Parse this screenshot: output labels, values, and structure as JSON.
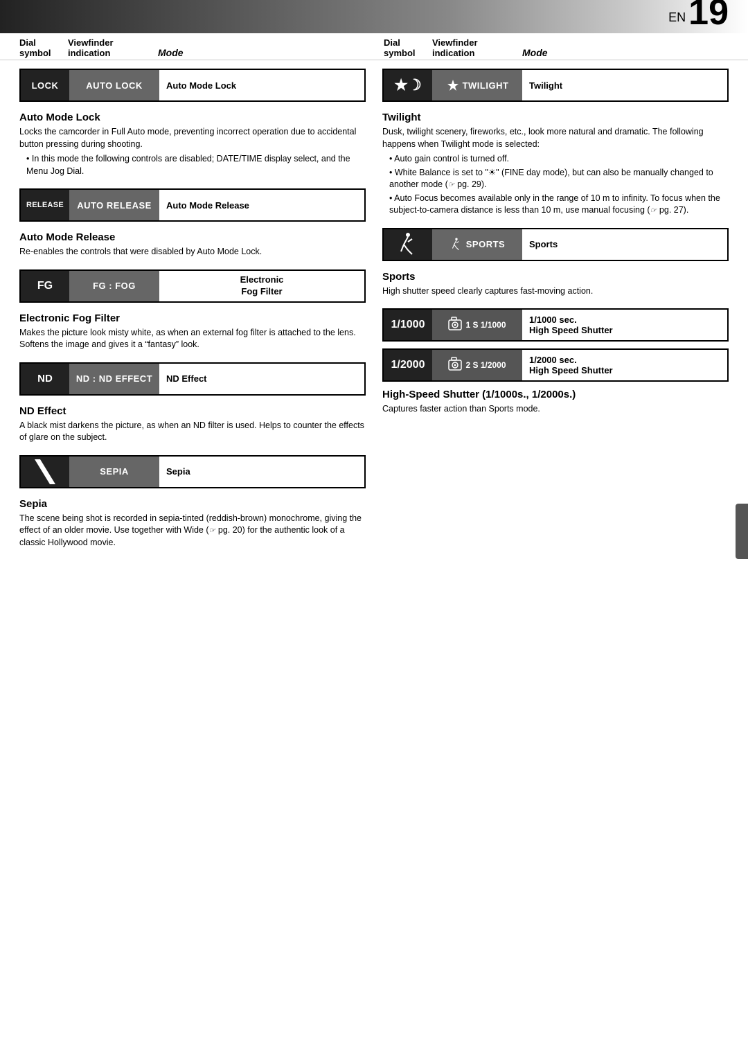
{
  "page": {
    "en_label": "EN",
    "page_number": "19"
  },
  "columns": {
    "left": {
      "header": {
        "symbol": "Dial\nsymbol",
        "indication": "Viewfinder\nindication",
        "mode": "Mode"
      },
      "sections": [
        {
          "id": "auto-mode-lock",
          "row": {
            "symbol_text": "LOCK",
            "indication_text": "AUTO LOCK",
            "mode_text": "Auto Mode Lock"
          },
          "title": "Auto Mode Lock",
          "body": "Locks the camcorder in Full Auto mode, preventing incorrect operation due to accidental button pressing during shooting.",
          "bullets": [
            "In this mode the following controls are disabled; DATE/TIME display select, and the Menu Jog Dial."
          ]
        },
        {
          "id": "auto-mode-release",
          "row": {
            "symbol_text": "RELEASE",
            "indication_text": "AUTO RELEASE",
            "mode_text": "Auto Mode Release"
          },
          "title": "Auto Mode Release",
          "body": "Re-enables the controls that were disabled by Auto Mode Lock.",
          "bullets": []
        },
        {
          "id": "electronic-fog-filter",
          "row": {
            "symbol_text": "FG",
            "indication_text": "FG : FOG",
            "mode_text": "Electronic\nFog Filter"
          },
          "title": "Electronic Fog Filter",
          "body": "Makes the picture look misty white, as when an external fog filter is attached to the lens. Softens the image and gives it a “fantasy” look.",
          "bullets": []
        },
        {
          "id": "nd-effect",
          "row": {
            "symbol_text": "ND",
            "indication_text": "ND : ND EFFECT",
            "mode_text": "ND Effect"
          },
          "title": "ND Effect",
          "body": "A black mist darkens the picture, as when an ND filter is used. Helps to counter the effects of glare on the subject.",
          "bullets": []
        },
        {
          "id": "sepia",
          "row": {
            "symbol_text": "╲",
            "indication_text": "SEPIA",
            "mode_text": "Sepia"
          },
          "title": "Sepia",
          "body": "The scene being shot is recorded in sepia-tinted (reddish-brown) monochrome, giving the effect of an older movie. Use together with Wide (ᵔᴷ pg. 20) for the authentic look of a classic Hollywood movie.",
          "bullets": []
        }
      ]
    },
    "right": {
      "header": {
        "symbol": "Dial\nsymbol",
        "indication": "Viewfinder\nindication",
        "mode": "Mode"
      },
      "sections": [
        {
          "id": "twilight",
          "row": {
            "symbol_text": "★☽",
            "indication_text": "TWILIGHT",
            "mode_text": "Twilight"
          },
          "title": "Twilight",
          "body": "Dusk, twilight scenery, fireworks, etc., look more natural and dramatic. The following happens when Twilight mode is selected:",
          "bullets": [
            "Auto gain control is turned off.",
            "White Balance is set to \"☀\" (FINE day mode), but can also be manually changed to another mode (ᵔᴷ pg. 29).",
            "Auto Focus becomes available only in the range of 10 m to infinity. To focus when the subject-to-camera distance is less than 10 m, use manual focusing (ᵔᴷ pg. 27)."
          ]
        },
        {
          "id": "sports",
          "row": {
            "symbol_text": "⛹",
            "indication_text": "SPORTS",
            "mode_text": "Sports"
          },
          "title": "Sports",
          "body": "High shutter speed clearly captures fast-moving action.",
          "bullets": []
        },
        {
          "id": "shutter-1000",
          "number": "1/1000",
          "icon_text": "►1 S 1/1000",
          "label_top": "1/1000 sec.",
          "label_bottom": "High Speed Shutter"
        },
        {
          "id": "shutter-2000",
          "number": "1/2000",
          "icon_text": "►2 S 1/2000",
          "label_top": "1/2000 sec.",
          "label_bottom": "High Speed Shutter"
        }
      ],
      "high_speed_title": "High-Speed Shutter (1/1000s., 1/2000s.)",
      "high_speed_body": "Captures faster action than Sports mode."
    }
  }
}
